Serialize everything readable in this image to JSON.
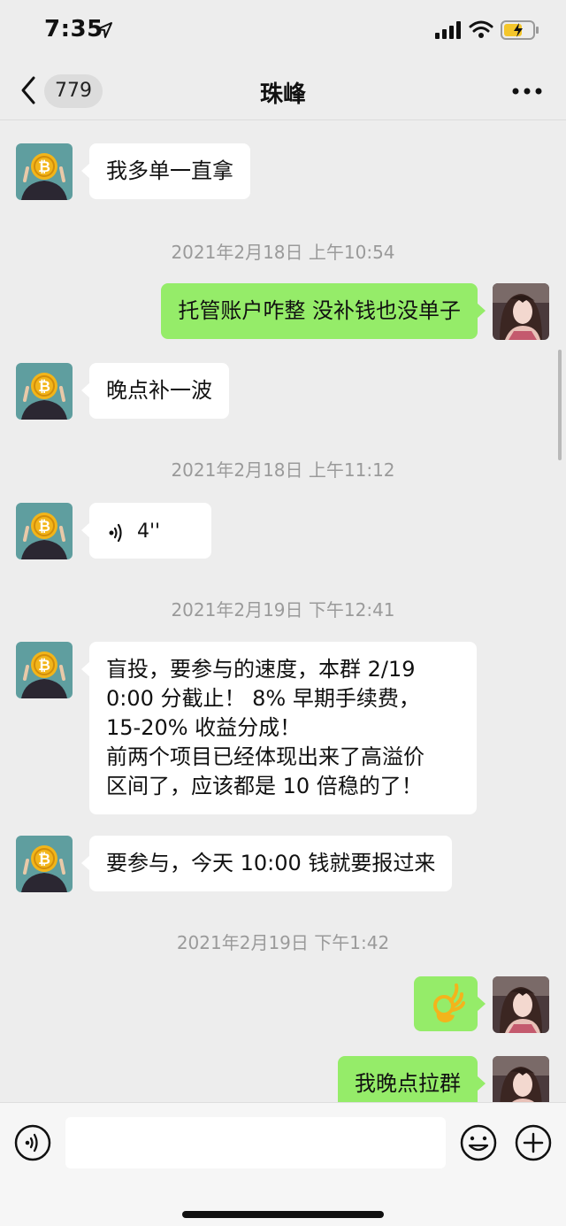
{
  "status_bar": {
    "time": "7:35"
  },
  "nav": {
    "unread_count": "779",
    "title": "珠峰"
  },
  "colors": {
    "outgoing_bubble": "#95ec69",
    "incoming_bubble": "#ffffff",
    "chat_background": "#ededed"
  },
  "messages": [
    {
      "direction": "in",
      "text": "我多单一直拿"
    },
    {
      "type": "time",
      "text": "2021年2月18日 上午10:54"
    },
    {
      "direction": "out",
      "text": "托管账户咋整 没补钱也没单子"
    },
    {
      "direction": "in",
      "text": "晚点补一波"
    },
    {
      "type": "time",
      "text": "2021年2月18日 上午11:12"
    },
    {
      "direction": "in",
      "type": "voice",
      "duration": "4''"
    },
    {
      "type": "time",
      "text": "2021年2月19日 下午12:41"
    },
    {
      "direction": "in",
      "lines": [
        "盲投，要参与的速度，本群 2/19",
        "0:00 分截止！  8% 早期手续费，",
        "15-20% 收益分成！",
        "前两个项目已经体现出来了高溢价",
        "区间了，应该都是 10 倍稳的了！"
      ]
    },
    {
      "direction": "in",
      "text": "要参与，今天 10:00 钱就要报过来"
    },
    {
      "type": "time",
      "text": "2021年2月19日 下午1:42"
    },
    {
      "direction": "out",
      "text": "👌",
      "icon": "ok-hand-emoji"
    },
    {
      "direction": "out",
      "text": "我晚点拉群"
    }
  ],
  "input": {
    "placeholder": "",
    "value": ""
  }
}
